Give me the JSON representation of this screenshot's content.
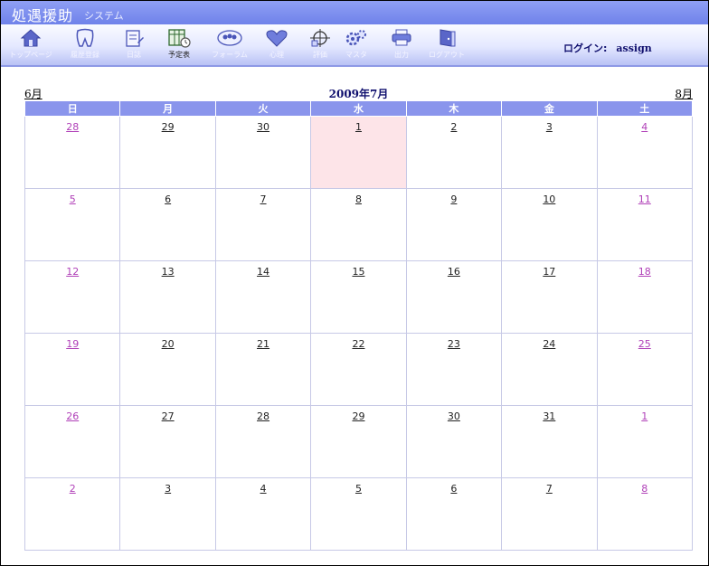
{
  "app": {
    "title": "処遇援助",
    "subtitle": "システム"
  },
  "toolbar": {
    "items": [
      {
        "label": "トップページ",
        "icon": "home-icon"
      },
      {
        "label": "履歴登録",
        "icon": "tooth-icon"
      },
      {
        "label": "日誌",
        "icon": "notes-icon"
      },
      {
        "label": "予定表",
        "icon": "calendar-icon",
        "active": true
      },
      {
        "label": "フォーラム",
        "icon": "people-icon"
      },
      {
        "label": "心理",
        "icon": "heart-icon"
      },
      {
        "label": "評価",
        "icon": "target-icon"
      },
      {
        "label": "マスタ",
        "icon": "gear-icon"
      },
      {
        "label": "出力",
        "icon": "printer-icon"
      },
      {
        "label": "ログアウト",
        "icon": "logout-icon"
      }
    ],
    "login_label": "ログイン:",
    "login_user": "assign"
  },
  "calendar": {
    "prev_label": "6月",
    "next_label": "8月",
    "title": "2009年7月",
    "weekdays": [
      "日",
      "月",
      "火",
      "水",
      "木",
      "金",
      "土"
    ],
    "weeks": [
      [
        "28",
        "29",
        "30",
        "1",
        "2",
        "3",
        "4"
      ],
      [
        "5",
        "6",
        "7",
        "8",
        "9",
        "10",
        "11"
      ],
      [
        "12",
        "13",
        "14",
        "15",
        "16",
        "17",
        "18"
      ],
      [
        "19",
        "20",
        "21",
        "22",
        "23",
        "24",
        "25"
      ],
      [
        "26",
        "27",
        "28",
        "29",
        "30",
        "31",
        "1"
      ],
      [
        "2",
        "3",
        "4",
        "5",
        "6",
        "7",
        "8"
      ]
    ],
    "today": "1",
    "weekend_color": "#b040b8",
    "header_color": "#8a95ec",
    "today_color": "#fde4e8"
  }
}
